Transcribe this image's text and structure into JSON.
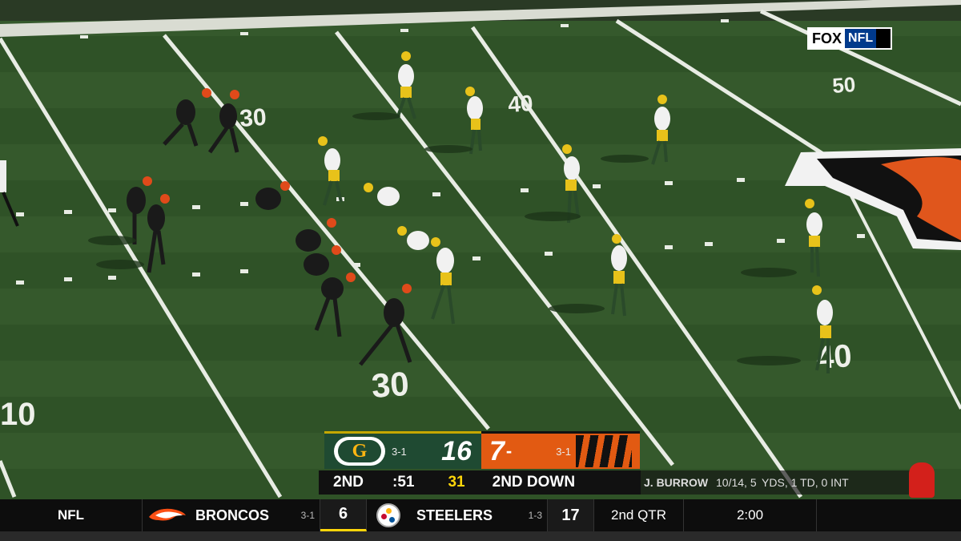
{
  "network": {
    "fox": "FOX",
    "league": "NFL"
  },
  "yard_markers": [
    "30",
    "40",
    "30",
    "40",
    "50",
    "10"
  ],
  "scorebug": {
    "home": {
      "record": "3-1",
      "score": "16",
      "logo_letter": "G",
      "color": "#1f4a32"
    },
    "away": {
      "score": "7",
      "timeout_dash": "-",
      "record": "3-1",
      "color": "#e25a12"
    },
    "quarter": "2ND",
    "clock": ":51",
    "play_clock": "31",
    "down": "2ND DOWN"
  },
  "stat_line": {
    "player": "J. BURROW",
    "line": "10/14, 5  YDS, 1 TD, 0 INT"
  },
  "ticker": {
    "league": "NFL",
    "team1": {
      "name": "BRONCOS",
      "record": "3-1",
      "score": "6"
    },
    "team2": {
      "name": "STEELERS",
      "record": "1-3",
      "score": "17"
    },
    "quarter": "2nd QTR",
    "clock": "2:00"
  },
  "icons": {
    "home_logo": "packers-logo-icon",
    "away_logo": "bengals-stripes-icon",
    "ticker_logo1": "broncos-logo-icon",
    "ticker_logo2": "steelers-logo-icon"
  }
}
